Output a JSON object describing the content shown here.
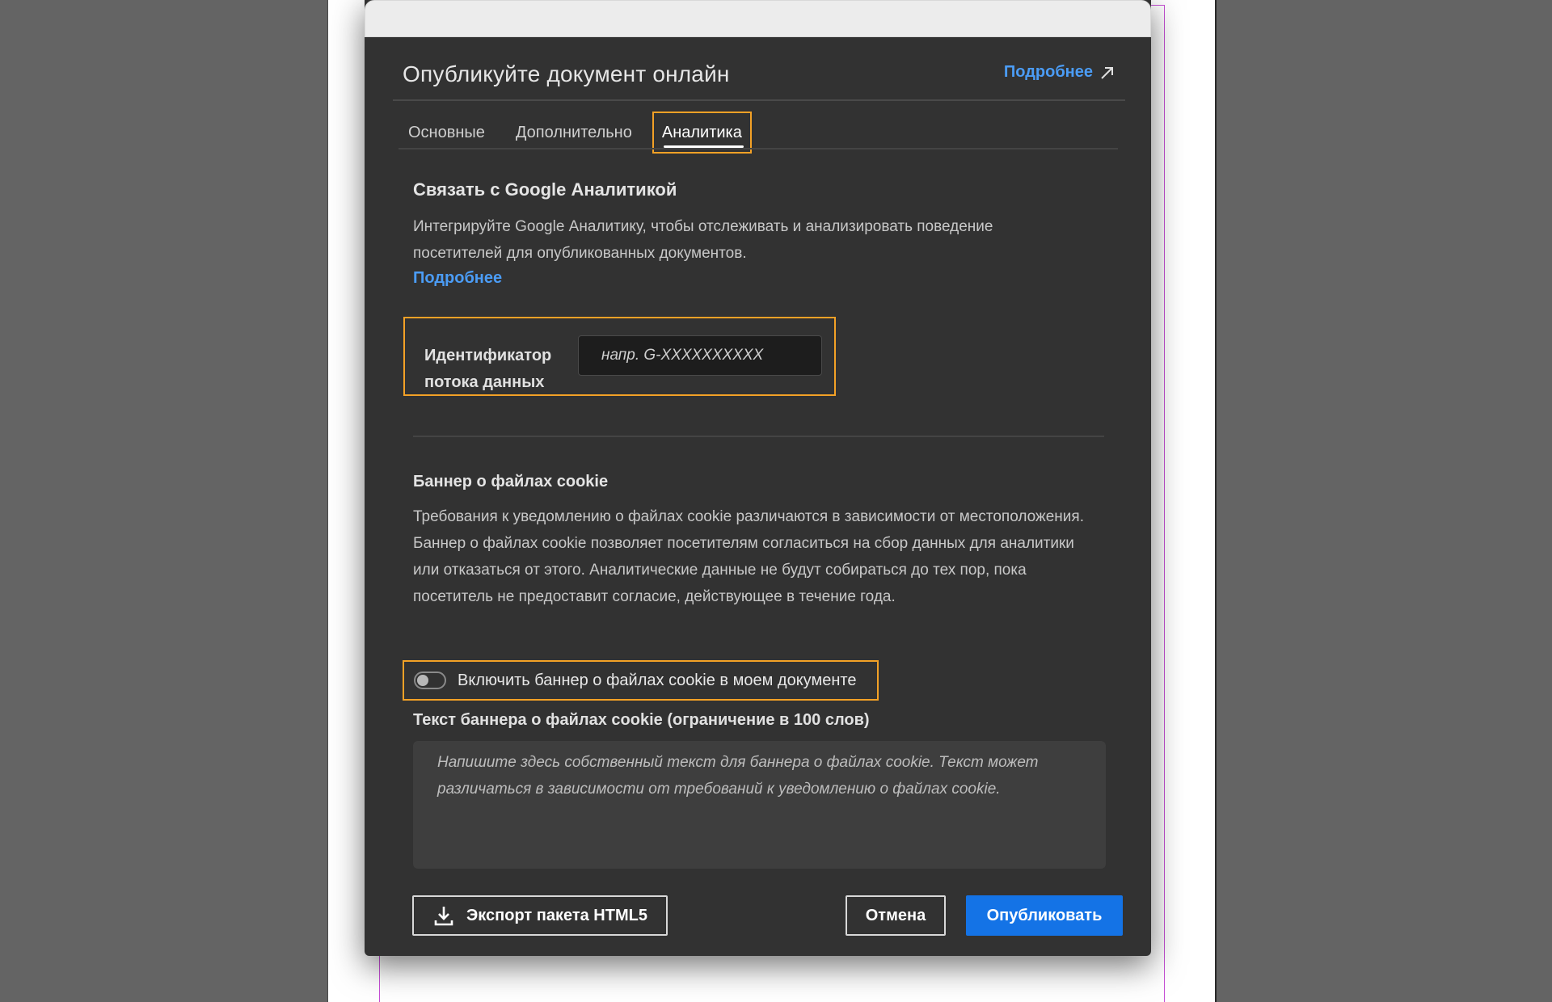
{
  "dialog": {
    "title": "Опубликуйте документ онлайн",
    "help_link": "Подробнее"
  },
  "tabs": [
    {
      "label": "Основные",
      "active": false
    },
    {
      "label": "Дополнительно",
      "active": false
    },
    {
      "label": "Аналитика",
      "active": true
    }
  ],
  "analytics": {
    "title": "Связать с Google Аналитикой",
    "description_line1": "Интегрируйте Google Аналитику, чтобы отслеживать и анализировать поведение",
    "description_line2": "посетителей для опубликованных документов.",
    "learn_more": "Подробнее",
    "stream_label_line1": "Идентификатор",
    "stream_label_line2": "потока данных",
    "stream_placeholder": "напр. G-XXXXXXXXXX",
    "stream_value": ""
  },
  "cookie": {
    "title": "Баннер о файлах cookie",
    "description_line1": "Требования к уведомлению о файлах cookie различаются в зависимости от местоположения.",
    "description_line2": "Баннер о файлах cookie позволяет посетителям согласиться на сбор данных для аналитики",
    "description_line3": "или отказаться от этого. Аналитические данные не будут собираться до тех пор, пока",
    "description_line4": "посетитель не предоставит согласие, действующее в течение года.",
    "toggle_label": "Включить баннер о файлах cookie в моем документе",
    "toggle_on": false,
    "banner_text_label": "Текст баннера о файлах cookie (ограничение в 100 слов)",
    "banner_placeholder": "Напишите здесь собственный текст для баннера о файлах cookie. Текст может различаться в зависимости от требований к уведомлению о файлах cookie.",
    "banner_value": ""
  },
  "footer": {
    "export_label": "Экспорт пакета HTML5",
    "cancel_label": "Отмена",
    "publish_label": "Опубликовать"
  },
  "colors": {
    "accent": "#1473e6",
    "link": "#4b9cf5",
    "highlight": "#f3a126",
    "dialog_bg": "#323232"
  }
}
